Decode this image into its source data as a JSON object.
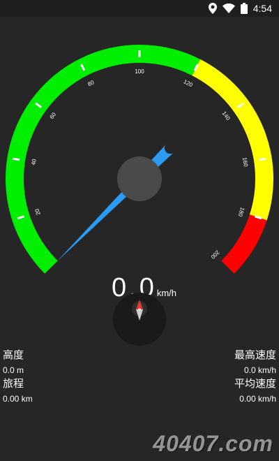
{
  "status_bar": {
    "time": "4:54",
    "icons": [
      "location-icon",
      "wifi-icon",
      "battery-icon"
    ]
  },
  "gauge": {
    "min": 0,
    "max": 200,
    "value": 0,
    "tick_labels": [
      "20",
      "40",
      "60",
      "80",
      "100",
      "120",
      "140",
      "160",
      "180",
      "200"
    ],
    "zones": [
      {
        "from": 0,
        "to": 120,
        "color": "#00ee00"
      },
      {
        "from": 120,
        "to": 180,
        "color": "#ffff00"
      },
      {
        "from": 180,
        "to": 200,
        "color": "#ff0000"
      }
    ],
    "needle_color": "#2b9bf4",
    "hub_color": "#4a4a4a"
  },
  "speed": {
    "value": "0.0",
    "unit": "km/h"
  },
  "compass": {
    "icon": "compass-icon",
    "north_color": "#e53935",
    "south_color": "#cfcfcf"
  },
  "stats": {
    "altitude": {
      "label": "高度",
      "value": "0.0 m"
    },
    "trip": {
      "label": "旅程",
      "value": "0.00 km"
    },
    "max_speed": {
      "label": "最高速度",
      "value": "0.0 km/h"
    },
    "avg_speed": {
      "label": "平均速度",
      "value": "0.00 km/h"
    }
  },
  "watermark": "40407.com"
}
